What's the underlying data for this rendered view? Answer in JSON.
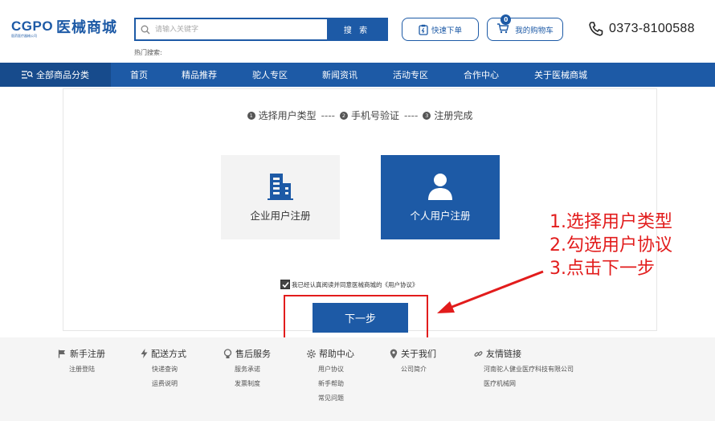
{
  "header": {
    "logo_mark": "CGPO",
    "logo_sub": "医药医疗器械公司",
    "logo_name": "医械商城",
    "search_placeholder": "请输入关键字",
    "search_button": "搜 索",
    "hot_search_label": "热门搜索:",
    "quick_order": "快速下单",
    "cart": "我的购物车",
    "cart_count": "0",
    "phone": "0373-8100588"
  },
  "nav": {
    "all_categories": "全部商品分类",
    "items": [
      "首页",
      "精品推荐",
      "驼人专区",
      "新闻资讯",
      "活动专区",
      "合作中心",
      "关于医械商城"
    ]
  },
  "steps": [
    {
      "num": "1",
      "label": "选择用户类型"
    },
    {
      "num": "2",
      "label": "手机号验证"
    },
    {
      "num": "3",
      "label": "注册完成"
    }
  ],
  "step_separator": "----",
  "user_types": {
    "company": "企业用户注册",
    "person": "个人用户注册",
    "selected": "person"
  },
  "agreement": {
    "text": "我已经认真阅读并同意医械商城的《用户协议》",
    "checked": true
  },
  "next_button": "下一步",
  "annotation": [
    "1.选择用户类型",
    "2.勾选用户协议",
    "3.点击下一步"
  ],
  "colors": {
    "brand": "#1d5aa6",
    "annotation": "#e21c1c"
  },
  "footer": [
    {
      "title": "新手注册",
      "icon": "flag-icon",
      "links": [
        "注册登陆"
      ]
    },
    {
      "title": "配送方式",
      "icon": "bolt-icon",
      "links": [
        "快递查询",
        "运费说明"
      ]
    },
    {
      "title": "售后服务",
      "icon": "bulb-icon",
      "links": [
        "服务承诺",
        "发票制度"
      ]
    },
    {
      "title": "帮助中心",
      "icon": "gear-icon",
      "links": [
        "用户协议",
        "新手帮助",
        "常见问题"
      ]
    },
    {
      "title": "关于我们",
      "icon": "location-icon",
      "links": [
        "公司简介"
      ]
    },
    {
      "title": "友情链接",
      "icon": "link-icon",
      "links": [
        "河南驼人健业医疗科技有限公司",
        "医疗机械网"
      ]
    }
  ]
}
